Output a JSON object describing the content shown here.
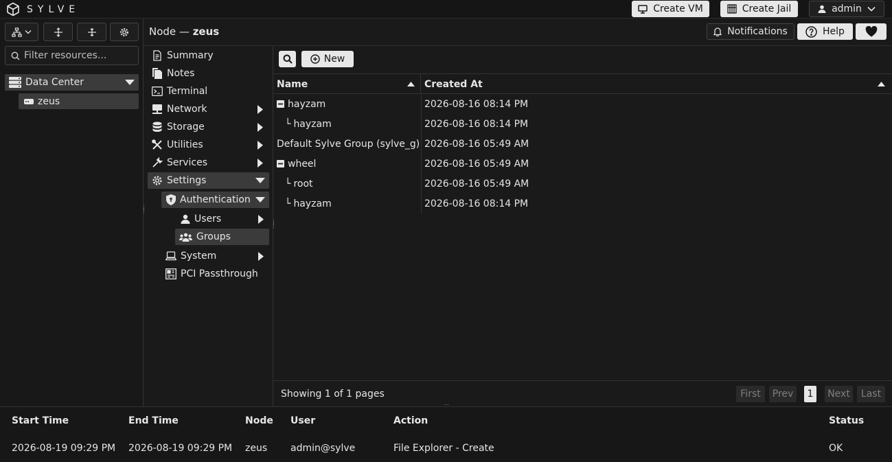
{
  "app": {
    "brand": "SYLVE"
  },
  "topbar": {
    "create_vm": "Create VM",
    "create_jail": "Create Jail",
    "user": "admin"
  },
  "left": {
    "filter_placeholder": "Filter resources...",
    "tree": [
      {
        "label": "Data Center"
      },
      {
        "label": "zeus"
      }
    ]
  },
  "header": {
    "crumb_prefix": "Node —",
    "crumb_node": "zeus",
    "notifications": "Notifications",
    "help": "Help"
  },
  "nav": [
    {
      "label": "Summary"
    },
    {
      "label": "Notes"
    },
    {
      "label": "Terminal"
    },
    {
      "label": "Network"
    },
    {
      "label": "Storage"
    },
    {
      "label": "Utilities"
    },
    {
      "label": "Services"
    },
    {
      "label": "Settings"
    },
    {
      "label": "Authentication"
    },
    {
      "label": "Users"
    },
    {
      "label": "Groups"
    },
    {
      "label": "System"
    },
    {
      "label": "PCI Passthrough"
    }
  ],
  "grid": {
    "new_label": "New",
    "columns": [
      {
        "label": "Name"
      },
      {
        "label": "Created At"
      }
    ],
    "rows": [
      {
        "name": "hayzam",
        "created": "2026-08-16 08:14 PM",
        "prefix": ""
      },
      {
        "name": "hayzam",
        "created": "2026-08-16 08:14 PM",
        "prefix": "└"
      },
      {
        "name": "Default Sylve Group (sylve_g)",
        "created": "2026-08-16 05:49 AM",
        "prefix": ""
      },
      {
        "name": "wheel",
        "created": "2026-08-16 05:49 AM",
        "prefix": ""
      },
      {
        "name": "root",
        "created": "2026-08-16 05:49 AM",
        "prefix": "└"
      },
      {
        "name": "hayzam",
        "created": "2026-08-16 08:14 PM",
        "prefix": "└"
      }
    ],
    "pager": {
      "status": "Showing 1 of 1 pages",
      "first": "First",
      "prev": "Prev",
      "page": "1",
      "next": "Next",
      "last": "Last"
    }
  },
  "tasks": {
    "columns": [
      {
        "label": "Start Time"
      },
      {
        "label": "End Time"
      },
      {
        "label": "Node"
      },
      {
        "label": "User"
      },
      {
        "label": "Action"
      },
      {
        "label": "Status"
      }
    ],
    "rows": [
      {
        "start": "2026-08-19 09:29 PM",
        "end": "2026-08-19 09:29 PM",
        "node": "zeus",
        "user": "admin@sylve",
        "action": "File Explorer - Create",
        "status": "OK"
      }
    ]
  },
  "colors": {
    "background": "#1a1a1a",
    "selected": "#3b3b3b",
    "light_button": "#e7e7e7"
  },
  "icons": [
    "cube-logo-icon",
    "monitor-icon",
    "jail-icon",
    "user-icon",
    "chevron-down-icon",
    "hierarchy-icon",
    "expand-icon",
    "collapse-icon",
    "gear-icon",
    "search-icon",
    "server-icon",
    "node-icon",
    "bell-icon",
    "help-icon",
    "heart-icon",
    "document-icon",
    "notes-icon",
    "terminal-icon",
    "network-icon",
    "storage-icon",
    "tools-icon",
    "services-icon",
    "shield-icon",
    "groups-icon",
    "laptop-icon",
    "pci-icon",
    "plus-circle-icon",
    "sort-asc-icon",
    "minus-square-icon"
  ]
}
